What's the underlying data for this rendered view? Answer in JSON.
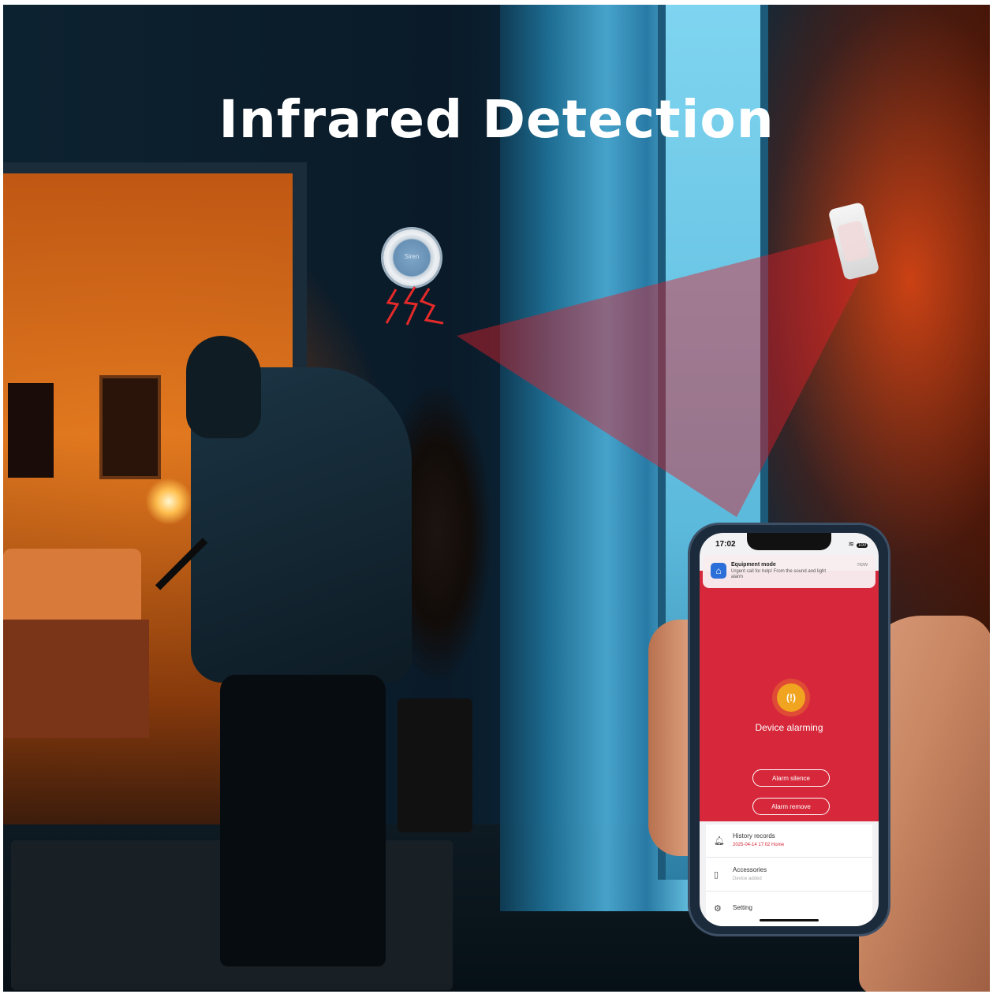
{
  "banner": {
    "title": "Infrared Detection"
  },
  "siren": {
    "label": "Siren"
  },
  "phone": {
    "status": {
      "time": "17:02",
      "battery": "100",
      "wifi_icon": "wifi-icon"
    },
    "notification": {
      "app_icon": "home-icon",
      "title": "Equipment mode",
      "body": "Urgent call for help! From the sound and light alarm",
      "time": "now"
    },
    "alarm": {
      "icon_text": "(!)",
      "status_text": "Device alarming",
      "silence_label": "Alarm silence",
      "remove_label": "Alarm remove"
    },
    "list": [
      {
        "icon": "bell-icon",
        "title": "History records",
        "subtitle": "2025-04-14 17:02 Home"
      },
      {
        "icon": "accessories-icon",
        "title": "Accessories",
        "subtitle": "Device added"
      },
      {
        "icon": "gear-icon",
        "title": "Setting",
        "subtitle": ""
      }
    ]
  },
  "colors": {
    "alarm_red": "#d6283a",
    "alarm_amber": "#f0a41f",
    "app_blue": "#2d6fd8"
  }
}
